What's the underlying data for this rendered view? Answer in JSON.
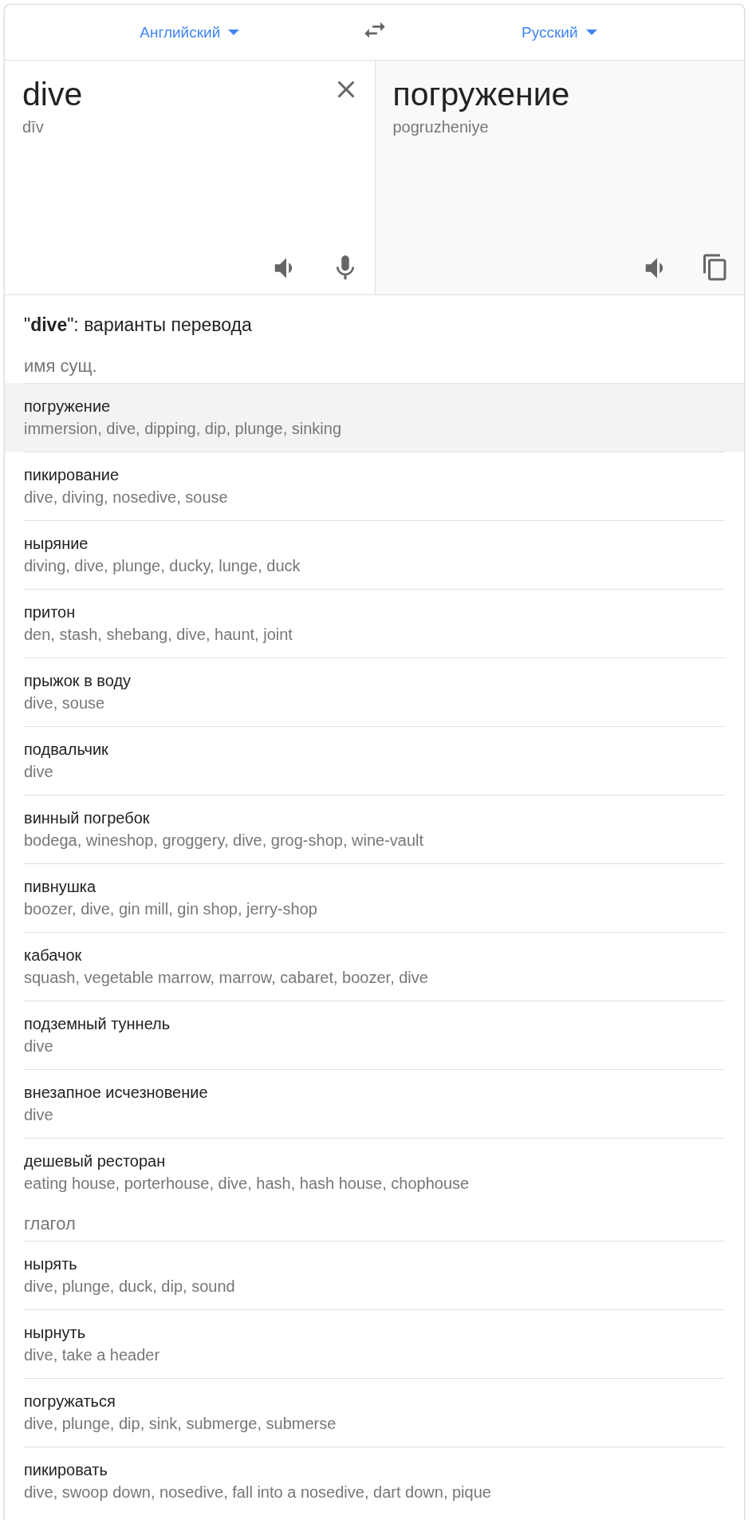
{
  "header": {
    "source_language": "Английский",
    "target_language": "Русский"
  },
  "source": {
    "text": "dive",
    "transliteration": "dīv"
  },
  "target": {
    "text": "погружение",
    "transliteration": "pogruzheniye"
  },
  "translations": {
    "title": "\"**dive**\": варианты перевода",
    "sections": [
      {
        "part_of_speech": "имя сущ.",
        "entries": [
          {
            "word": "погружение",
            "translations": "immersion, dive, dipping, dip, plunge, sinking",
            "selected": true
          },
          {
            "word": "пикирование",
            "translations": "dive, diving, nosedive, souse",
            "selected": false
          },
          {
            "word": "ныряние",
            "translations": "diving, dive, plunge, ducky, lunge, duck",
            "selected": false
          },
          {
            "word": "притон",
            "translations": "den, stash, shebang, dive, haunt, joint",
            "selected": false
          },
          {
            "word": "прыжок в воду",
            "translations": "dive, souse",
            "selected": false
          },
          {
            "word": "подвальчик",
            "translations": "dive",
            "selected": false
          },
          {
            "word": "винный погребок",
            "translations": "bodega, wineshop, groggery, dive, grog-shop, wine-vault",
            "selected": false
          },
          {
            "word": "пивнушка",
            "translations": "boozer, dive, gin mill, gin shop, jerry-shop",
            "selected": false
          },
          {
            "word": "кабачок",
            "translations": "squash, vegetable marrow, marrow, cabaret, boozer, dive",
            "selected": false
          },
          {
            "word": "подземный туннель",
            "translations": "dive",
            "selected": false
          },
          {
            "word": "внезапное исчезновение",
            "translations": "dive",
            "selected": false
          },
          {
            "word": "дешевый ресторан",
            "translations": "eating house, porterhouse, dive, hash, hash house, chophouse",
            "selected": false
          }
        ]
      },
      {
        "part_of_speech": "глагол",
        "entries": [
          {
            "word": "нырять",
            "translations": "dive, plunge, duck, dip, sound",
            "selected": false
          },
          {
            "word": "нырнуть",
            "translations": "dive, take a header",
            "selected": false
          },
          {
            "word": "погружаться",
            "translations": "dive, plunge, dip, sink, submerge, submerse",
            "selected": false
          },
          {
            "word": "пикировать",
            "translations": "dive, swoop down, nosedive, fall into a nosedive, dart down, pique",
            "selected": false
          }
        ]
      }
    ]
  }
}
